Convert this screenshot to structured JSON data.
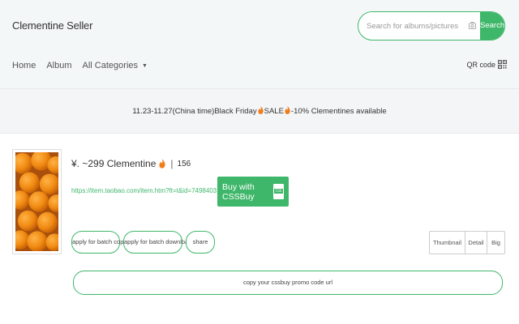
{
  "header": {
    "site_title": "Clementine Seller",
    "search_placeholder": "Search for albums/pictures",
    "search_button": "Search",
    "icons": {
      "camera": "camera-icon",
      "qr": "qr-code-icon"
    }
  },
  "nav": {
    "items": [
      "Home",
      "Album",
      "All Categories"
    ],
    "categories_caret": "▼",
    "qr_label": "QR code"
  },
  "banner": {
    "part1": "11.23-11.27(China time)Black Friday",
    "part2": "SALE",
    "part3": "-10% Clementines available"
  },
  "product": {
    "title": "¥. ~299 Clementine",
    "count_separator": "|",
    "count": "156",
    "link": "https://item.taobao.com/item.htm?ft=t&id=7498403",
    "buy_button": "Buy with CSSBuy",
    "buy_badge": "CSS"
  },
  "actions": {
    "batch_copy": "apply for batch copy",
    "batch_download": "apply for batch download",
    "share": "share"
  },
  "view_modes": [
    "Thumbnail",
    "Detail",
    "Big"
  ],
  "promo": "copy your cssbuy promo code url",
  "colors": {
    "accent": "#3fb76a",
    "flame": "#f07d1a",
    "header_bg": "#f4f7f8"
  }
}
